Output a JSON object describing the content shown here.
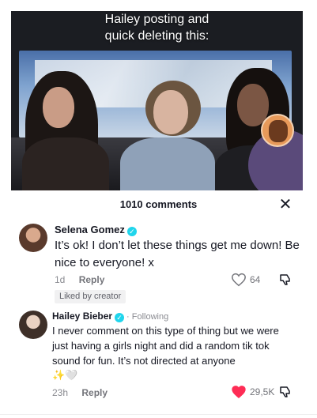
{
  "video": {
    "caption": "Hailey posting and\nquick deleting this:"
  },
  "comments_header": {
    "count_label": "1010 comments",
    "close_icon": "close-icon"
  },
  "comments": [
    {
      "author": "Selena Gomez",
      "verified": true,
      "text": "It’s ok! I don’t let these things get me down! Be nice to everyone! x",
      "age": "1d",
      "reply_label": "Reply",
      "likes": "64",
      "liked": false,
      "badge": "Liked by creator"
    },
    {
      "author": "Hailey Bieber",
      "verified": true,
      "following_label": "· Following",
      "text": "I never comment on this type of thing but we were just having a girls night and did a random tik tok sound for fun. It’s not directed at anyone",
      "emojis": "✨🤍",
      "age": "23h",
      "reply_label": "Reply",
      "likes": "29,5K",
      "liked": true
    }
  ],
  "colors": {
    "liked_heart": "#fe2c55",
    "verified": "#20d5ec",
    "muted_text": "#8a8b91"
  }
}
